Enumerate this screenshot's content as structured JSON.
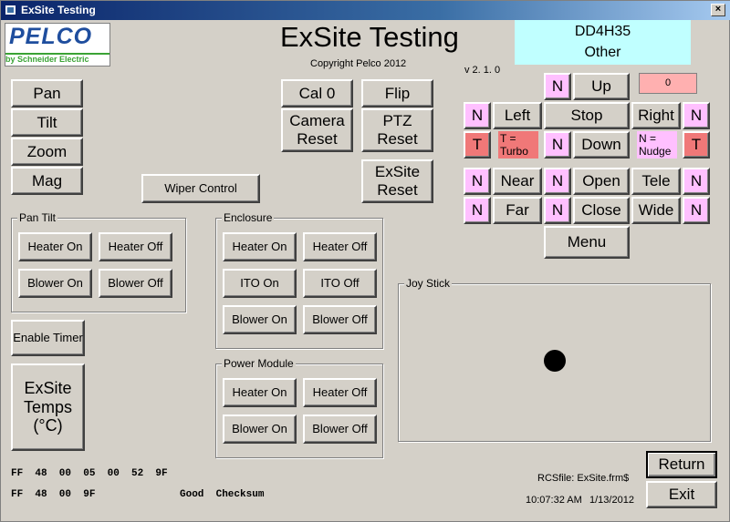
{
  "window": {
    "title": "ExSite Testing",
    "close_glyph": "×"
  },
  "logo": {
    "brand": "PELCO",
    "sub": "by Schneider Electric"
  },
  "header": {
    "title": "ExSite Testing",
    "copyright": "Copyright Pelco 2012",
    "version": "v 2. 1. 0",
    "device_line1": "DD4H35",
    "device_line2": "Other"
  },
  "left_buttons": {
    "pan": "Pan",
    "tilt": "Tilt",
    "zoom": "Zoom",
    "mag": "Mag"
  },
  "center_buttons": {
    "cal0": "Cal 0",
    "flip": "Flip",
    "camera_reset": "Camera Reset",
    "ptz_reset": "PTZ Reset",
    "exsite_reset": "ExSite Reset",
    "wiper": "Wiper Control"
  },
  "pan_tilt": {
    "label": "Pan Tilt",
    "heater_on": "Heater On",
    "heater_off": "Heater Off",
    "blower_on": "Blower On",
    "blower_off": "Blower Off"
  },
  "enclosure": {
    "label": "Enclosure",
    "heater_on": "Heater On",
    "heater_off": "Heater Off",
    "ito_on": "ITO On",
    "ito_off": "ITO Off",
    "blower_on": "Blower On",
    "blower_off": "Blower Off"
  },
  "power_module": {
    "label": "Power Module",
    "heater_on": "Heater On",
    "heater_off": "Heater Off",
    "blower_on": "Blower On",
    "blower_off": "Blower Off"
  },
  "timer": {
    "enable": "Enable Timer",
    "temps": "ExSite Temps (°C)"
  },
  "ptz": {
    "n": "N",
    "t": "T",
    "up": "Up",
    "down": "Down",
    "left": "Left",
    "right": "Right",
    "stop": "Stop",
    "near": "Near",
    "far": "Far",
    "open": "Open",
    "close": "Close",
    "tele": "Tele",
    "wide": "Wide",
    "menu": "Menu",
    "counter": "0",
    "turbo_note": "T = Turbo",
    "nudge_note": "N = Nudge"
  },
  "joystick": {
    "label": "Joy Stick"
  },
  "status": {
    "hex1": "FF  48  00  05  00  52  9F",
    "hex2": "FF  48  00  9F",
    "checksum": "Good  Checksum",
    "rcsfile": "RCSfile: ExSite.frm$",
    "time": "10:07:32 AM",
    "date": "1/13/2012"
  },
  "footer": {
    "return": "Return",
    "exit": "Exit"
  },
  "colors": {
    "face": "#d4d0c8",
    "n_button": "#ffc0ff",
    "t_button": "#f07878",
    "device_box": "#c0ffff",
    "counter_box": "#ffb0b0"
  }
}
